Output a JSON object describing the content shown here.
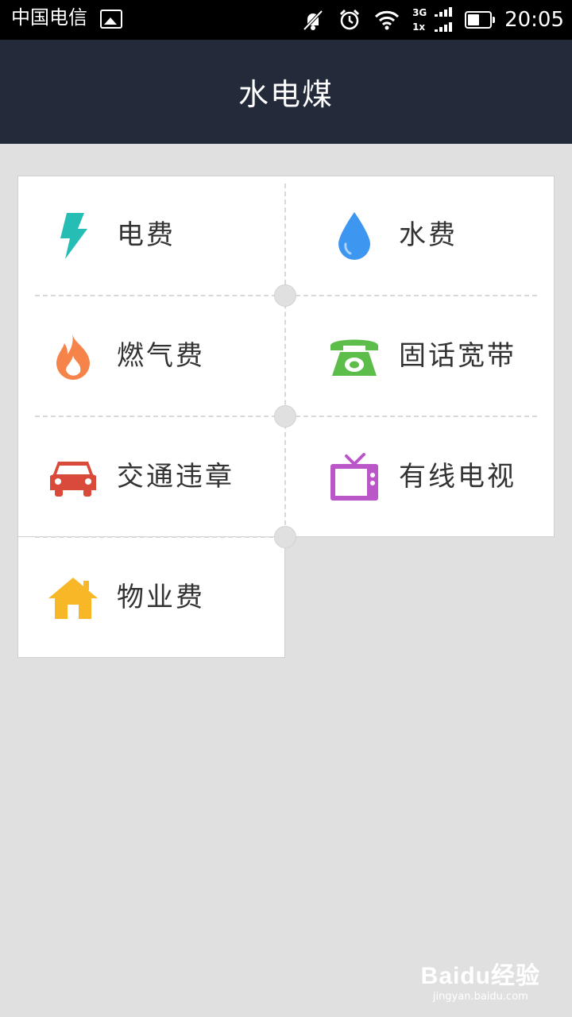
{
  "status_bar": {
    "carrier": "中国电信",
    "network_top": "3G",
    "network_bottom": "1x",
    "time": "20:05",
    "battery_level": 0.55
  },
  "header": {
    "title": "水电煤"
  },
  "services": [
    {
      "label": "电费",
      "icon": "lightning-icon",
      "color": "#26bdb5"
    },
    {
      "label": "水费",
      "icon": "water-drop-icon",
      "color": "#3d96f0"
    },
    {
      "label": "燃气费",
      "icon": "flame-icon",
      "color": "#f6844a"
    },
    {
      "label": "固话宽带",
      "icon": "telephone-icon",
      "color": "#5cbd4a"
    },
    {
      "label": "交通违章",
      "icon": "car-icon",
      "color": "#d94a3a"
    },
    {
      "label": "有线电视",
      "icon": "tv-icon",
      "color": "#bb56c8"
    },
    {
      "label": "物业费",
      "icon": "house-icon",
      "color": "#f8b727"
    }
  ],
  "watermark": {
    "brand": "Baidu经验",
    "url": "jingyan.baidu.com"
  }
}
